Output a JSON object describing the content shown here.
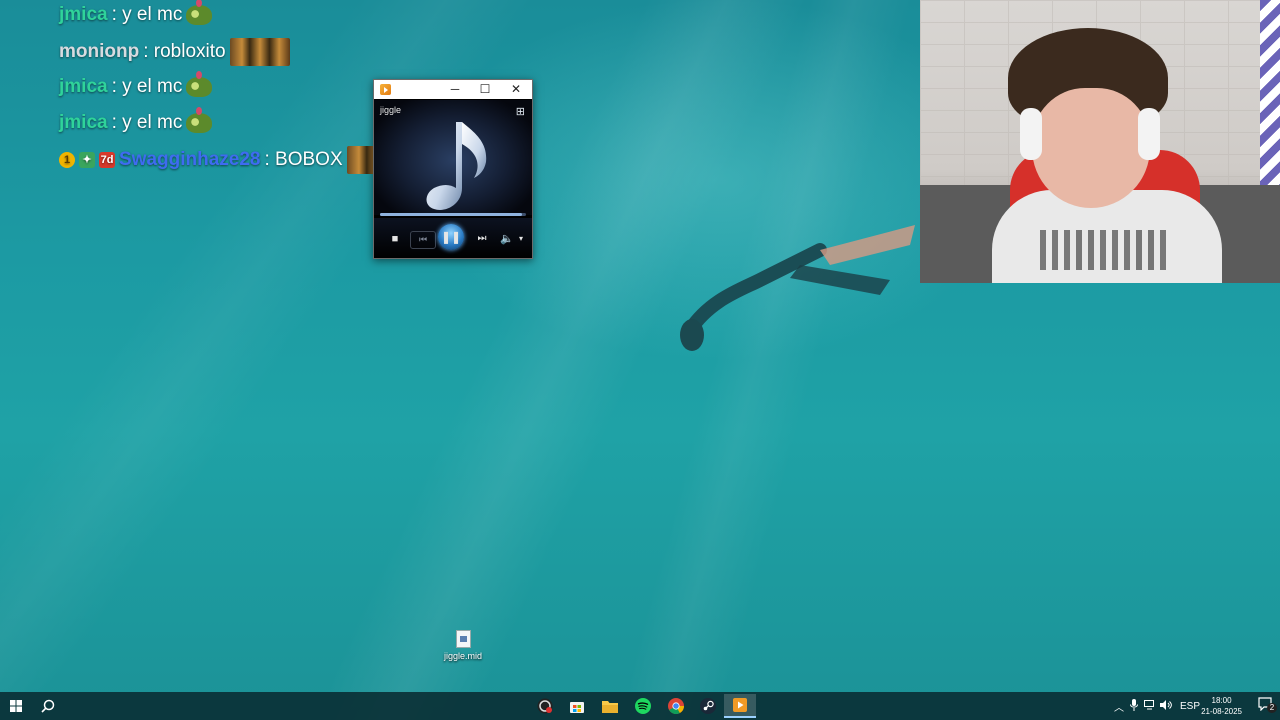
{
  "chat": {
    "messages": [
      {
        "user": "jmica",
        "user_color": "#2fd39a",
        "text": ": y el mc",
        "emote": "pepe-emote"
      },
      {
        "user": "monionp",
        "user_color": "#d8dbe0",
        "text": ": robloxito",
        "emote": "minions-emote"
      },
      {
        "user": "jmica",
        "user_color": "#2fd39a",
        "text": ": y el mc",
        "emote": "pepe-emote"
      },
      {
        "user": "jmica",
        "user_color": "#2fd39a",
        "text": ": y el mc",
        "emote": "pepe-emote"
      },
      {
        "user": "Swagginhaze28",
        "user_color": "#3f6bf0",
        "text": ": BOBOX",
        "emote": "minions-emote",
        "badges": [
          "1",
          "7d"
        ]
      }
    ]
  },
  "media_player": {
    "window_title": "",
    "track_title": "jiggle",
    "progress": 0.97,
    "controls": {
      "stop": "■",
      "previous": "⏮",
      "play_pause": "❚❚",
      "next": "⏭",
      "volume": "🔈",
      "volume_menu": "▾"
    },
    "window_buttons": {
      "minimize": "─",
      "maximize": "☐",
      "close": "✕"
    }
  },
  "desktop": {
    "icons": [
      {
        "label": "jiggle.mid",
        "icon": "midi-file-icon"
      }
    ]
  },
  "taskbar": {
    "start_icon": "windows-start-icon",
    "search_icon": "search-icon",
    "pinned": [
      {
        "name": "obs-icon",
        "active": false
      },
      {
        "name": "store-icon",
        "active": false
      },
      {
        "name": "file-explorer-icon",
        "active": false
      },
      {
        "name": "spotify-icon",
        "active": false
      },
      {
        "name": "chrome-icon",
        "active": false
      },
      {
        "name": "steam-icon",
        "active": false
      },
      {
        "name": "media-player-icon",
        "active": true
      }
    ],
    "tray": {
      "language": "ESP",
      "time": "18:00",
      "date": "21-08-2025",
      "notification_count": "2"
    }
  },
  "colors": {
    "accent": "#9ad1ff",
    "water": "#1c9aa3"
  }
}
